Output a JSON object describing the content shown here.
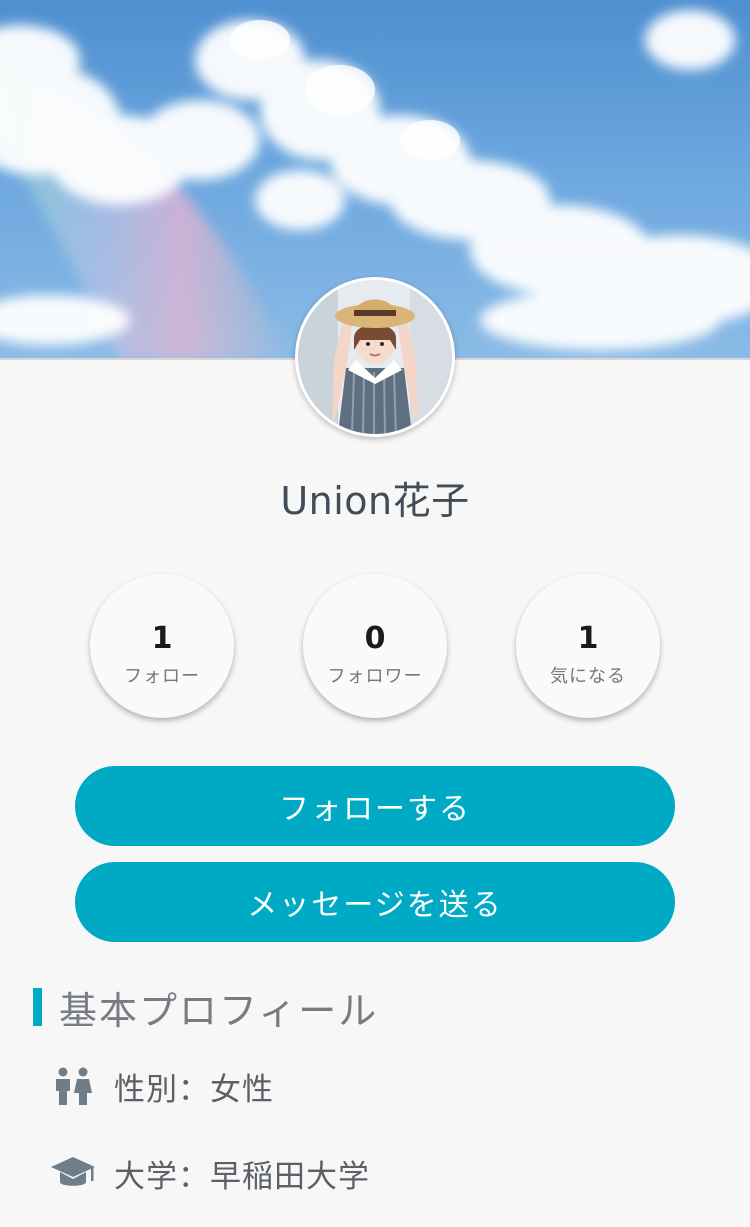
{
  "profile": {
    "name": "Union花子"
  },
  "stats": [
    {
      "value": "1",
      "label": "フォロー"
    },
    {
      "value": "0",
      "label": "フォロワー"
    },
    {
      "value": "1",
      "label": "気になる"
    }
  ],
  "actions": {
    "follow_label": "フォローする",
    "message_label": "メッセージを送る"
  },
  "basic_profile": {
    "title": "基本プロフィール",
    "gender": {
      "icon": "restroom-icon",
      "text": "性別：女性"
    },
    "university": {
      "icon": "graduation-cap-icon",
      "text": "大学：早稲田大学"
    }
  },
  "colors": {
    "accent": "#00aac4",
    "background": "#f7f7f7"
  }
}
